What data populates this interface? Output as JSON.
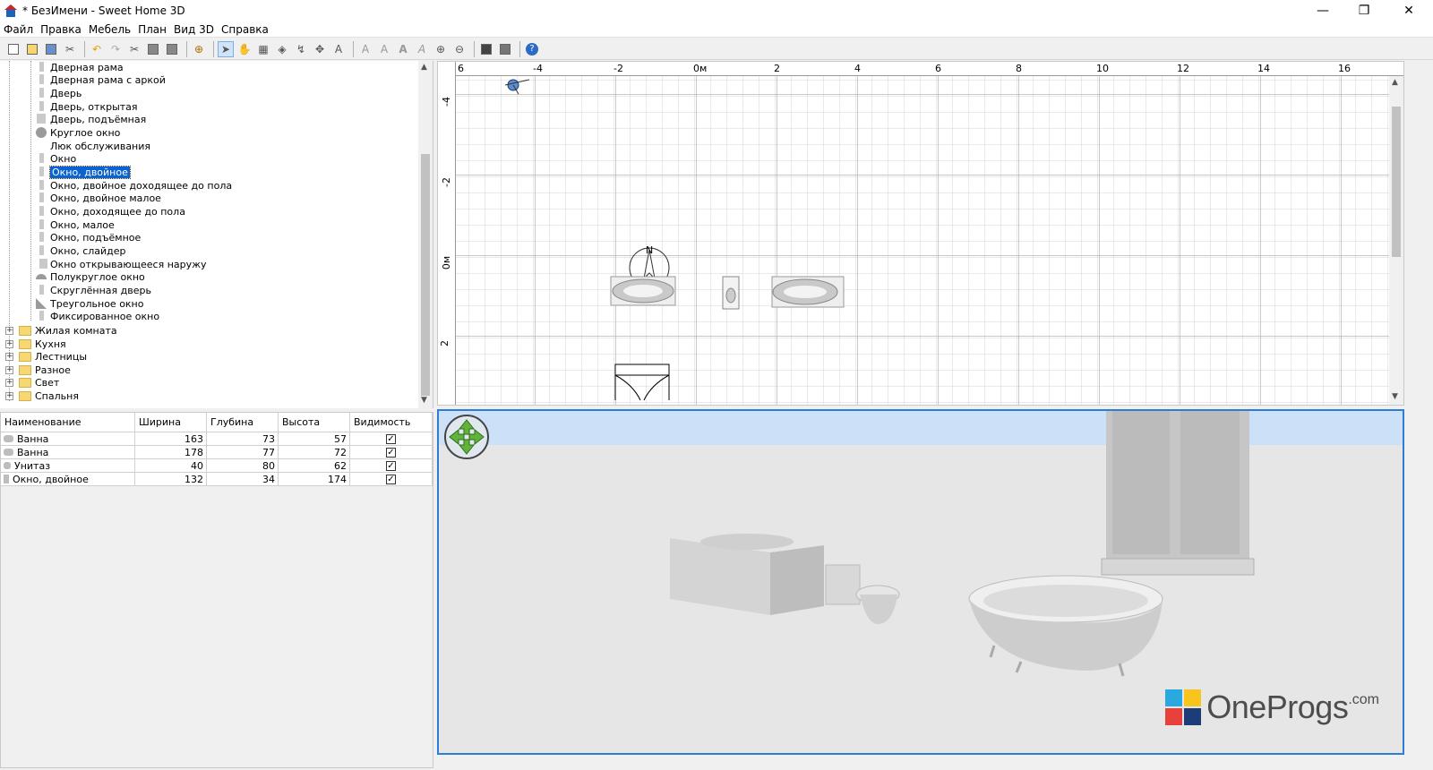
{
  "window": {
    "title": "* БезИмени - Sweet Home 3D",
    "minimize_glyph": "—",
    "restore_glyph": "❐",
    "close_glyph": "✕"
  },
  "menu": [
    "Файл",
    "Правка",
    "Мебель",
    "План",
    "Вид 3D",
    "Справка"
  ],
  "toolbar": {
    "icons": [
      "new-icon",
      "open-icon",
      "save-icon",
      "cut-icon",
      "undo-icon",
      "redo-icon",
      "cut-icon",
      "copy-icon",
      "paste-icon",
      "add-furniture-icon",
      "select-icon",
      "pan-icon",
      "create-walls-icon",
      "create-rooms-icon",
      "create-polylines-icon",
      "create-dimensions-icon",
      "add-text-icon",
      "increase-text-icon",
      "decrease-text-icon",
      "bold-icon",
      "italic-icon",
      "zoom-in-icon",
      "zoom-out-icon",
      "photo-icon",
      "video-icon",
      "help-icon"
    ]
  },
  "catalog": {
    "items": [
      {
        "label": "Дверная рама",
        "thumb": "rect"
      },
      {
        "label": "Дверная рама с аркой",
        "thumb": "rect"
      },
      {
        "label": "Дверь",
        "thumb": "rect"
      },
      {
        "label": "Дверь, открытая",
        "thumb": "rect"
      },
      {
        "label": "Дверь, подъёмная",
        "thumb": "rect"
      },
      {
        "label": "Круглое окно",
        "thumb": "circle"
      },
      {
        "label": "Люк обслуживания",
        "thumb": "none"
      },
      {
        "label": "Окно",
        "thumb": "rect"
      },
      {
        "label": "Окно, двойное",
        "thumb": "rect",
        "selected": true
      },
      {
        "label": "Окно, двойное доходящее до пола",
        "thumb": "rect"
      },
      {
        "label": "Окно, двойное малое",
        "thumb": "rect"
      },
      {
        "label": "Окно, доходящее до пола",
        "thumb": "rect"
      },
      {
        "label": "Окно, малое",
        "thumb": "rect"
      },
      {
        "label": "Окно, подъёмное",
        "thumb": "rect"
      },
      {
        "label": "Окно, слайдер",
        "thumb": "rect"
      },
      {
        "label": "Окно открывающееся наружу",
        "thumb": "rect"
      },
      {
        "label": "Полукруглое окно",
        "thumb": "half"
      },
      {
        "label": "Скруглённая дверь",
        "thumb": "rect"
      },
      {
        "label": "Треугольное окно",
        "thumb": "tri"
      },
      {
        "label": "Фиксированное окно",
        "thumb": "rect"
      }
    ],
    "categories": [
      "Жилая комната",
      "Кухня",
      "Лестницы",
      "Разное",
      "Свет",
      "Спальня"
    ]
  },
  "furniture_table": {
    "headers": [
      "Наименование",
      "Ширина",
      "Глубина",
      "Высота",
      "Видимость"
    ],
    "rows": [
      {
        "name": "Ванна",
        "width": "163",
        "depth": "73",
        "height": "57",
        "visible": "✓"
      },
      {
        "name": "Ванна",
        "width": "178",
        "depth": "77",
        "height": "72",
        "visible": "✓"
      },
      {
        "name": "Унитаз",
        "width": "40",
        "depth": "80",
        "height": "62",
        "visible": "✓"
      },
      {
        "name": "Окно, двойное",
        "width": "132",
        "depth": "34",
        "height": "174",
        "visible": "✓"
      }
    ]
  },
  "plan": {
    "x_ticks": [
      "6",
      "-4",
      "-2",
      "0м",
      "2",
      "4",
      "6",
      "8",
      "10",
      "12",
      "14",
      "16"
    ],
    "y_ticks": [
      "-4",
      "-2",
      "0м",
      "2"
    ],
    "compass_label": "N"
  },
  "watermark": {
    "text": "OneProgs",
    "suffix": ".com"
  }
}
